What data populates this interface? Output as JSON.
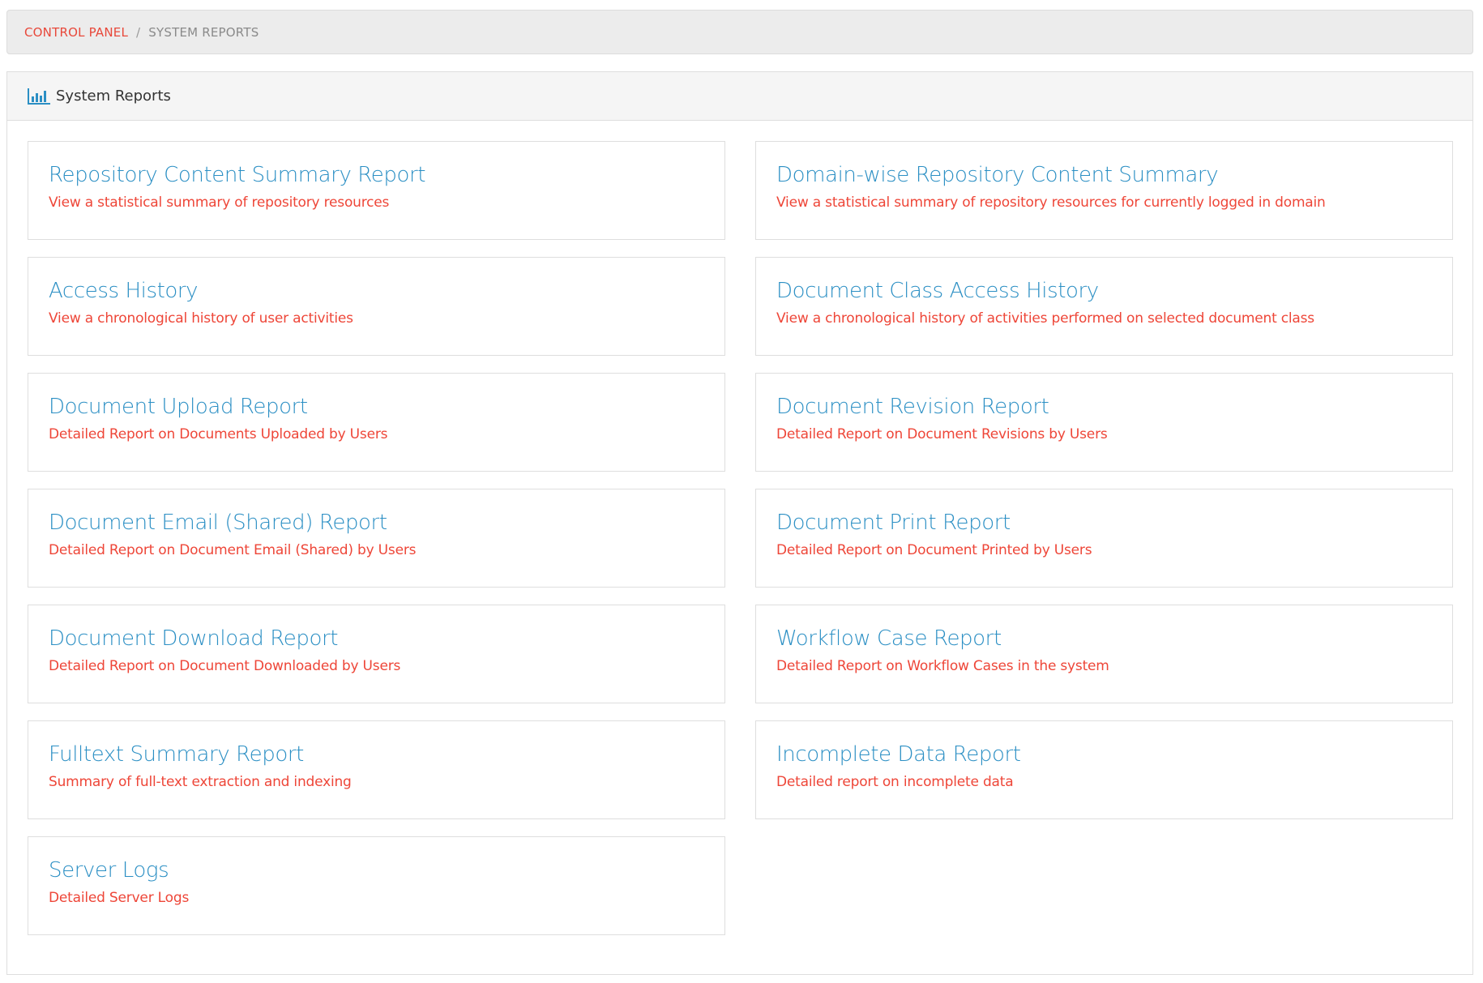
{
  "breadcrumb": {
    "items": [
      {
        "label": "CONTROL PANEL",
        "link": true
      },
      {
        "label": "SYSTEM REPORTS",
        "link": false
      }
    ],
    "separator": "/"
  },
  "panel": {
    "icon": "bar-chart-icon",
    "title": "System Reports"
  },
  "colors": {
    "title_blue": "#2b8fc4",
    "desc_red": "#ee4638",
    "breadcrumb_link": "#e8483a"
  },
  "reports": [
    {
      "title": "Repository Content Summary Report",
      "description": "View a statistical summary of repository resources"
    },
    {
      "title": "Domain-wise Repository Content Summary",
      "description": "View a statistical summary of repository resources for currently logged in domain"
    },
    {
      "title": "Access History",
      "description": "View a chronological history of user activities"
    },
    {
      "title": "Document Class Access History",
      "description": "View a chronological history of activities performed on selected document class"
    },
    {
      "title": "Document Upload Report",
      "description": "Detailed Report on Documents Uploaded by Users"
    },
    {
      "title": "Document Revision Report",
      "description": "Detailed Report on Document Revisions by Users"
    },
    {
      "title": "Document Email (Shared) Report",
      "description": "Detailed Report on Document Email (Shared) by Users"
    },
    {
      "title": "Document Print Report",
      "description": "Detailed Report on Document Printed by Users"
    },
    {
      "title": "Document Download Report",
      "description": "Detailed Report on Document Downloaded by Users"
    },
    {
      "title": "Workflow Case Report",
      "description": "Detailed Report on Workflow Cases in the system"
    },
    {
      "title": "Fulltext Summary Report",
      "description": "Summary of full-text extraction and indexing"
    },
    {
      "title": "Incomplete Data Report",
      "description": "Detailed report on incomplete data"
    },
    {
      "title": "Server Logs",
      "description": "Detailed Server Logs"
    }
  ]
}
